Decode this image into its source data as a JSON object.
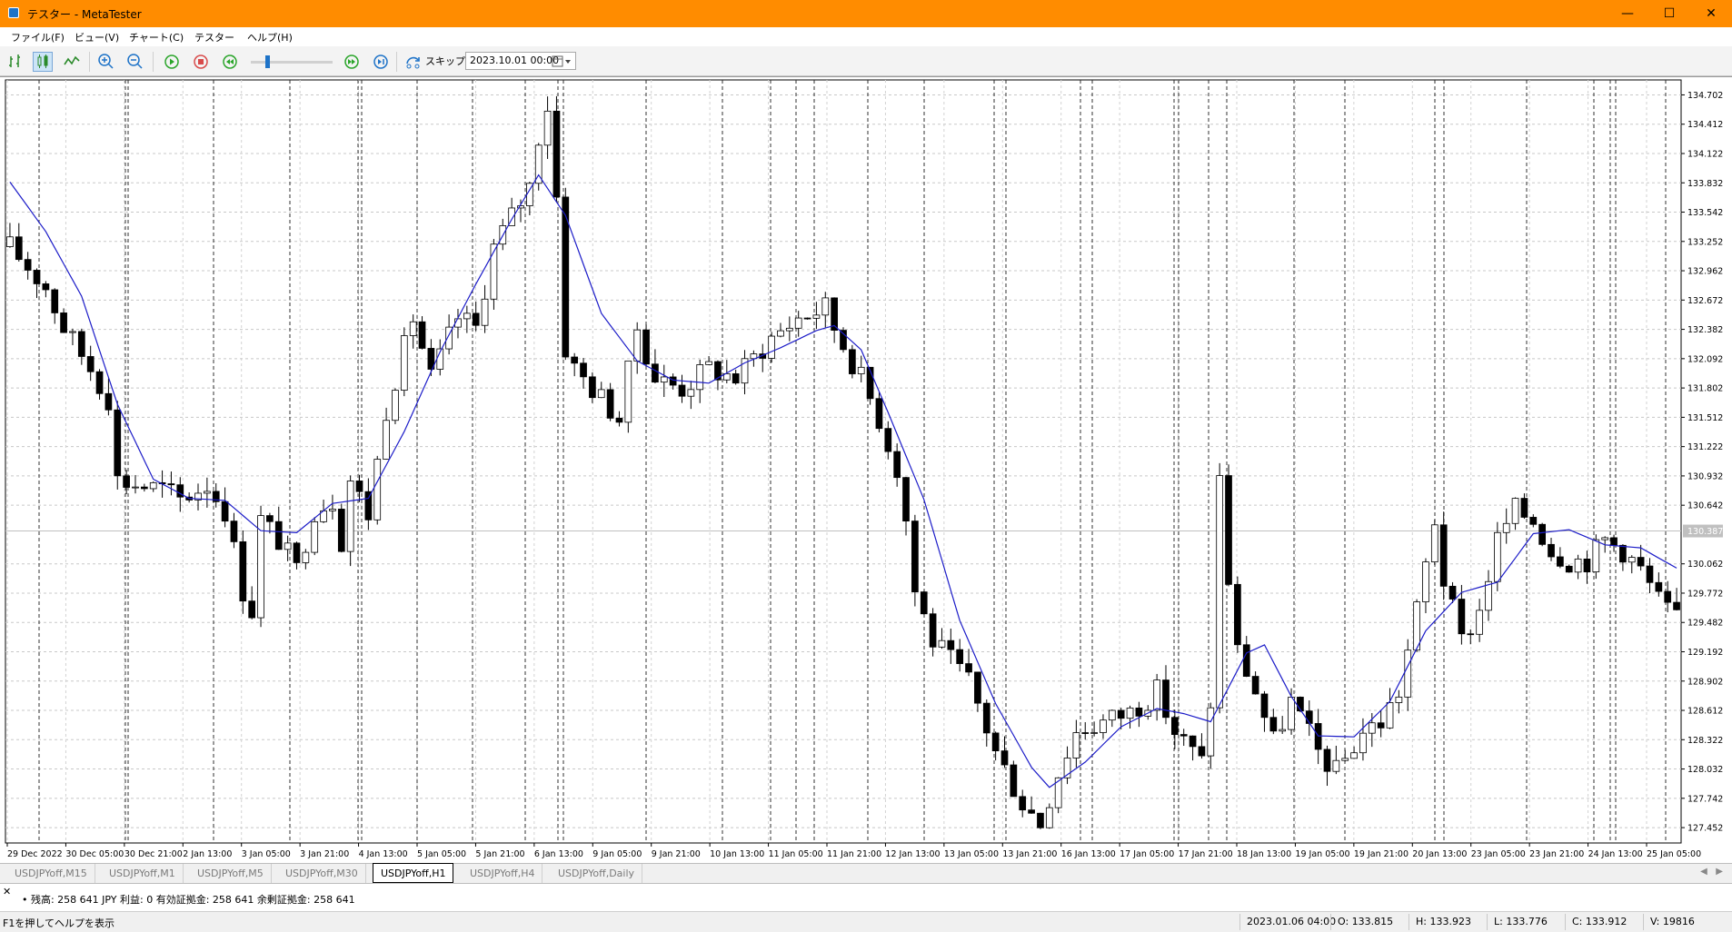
{
  "window": {
    "title": "テスター - MetaTester"
  },
  "menu": [
    "ファイル(F)",
    "ビュー(V)",
    "チャート(C)",
    "テスター",
    "ヘルプ(H)"
  ],
  "toolbar": {
    "skip_label": "スキップ",
    "date_value": "2023.10.01 00:00"
  },
  "chart_data": {
    "type": "candlestick",
    "symbol": "USDJPYoff",
    "timeframe": "H1",
    "ylim": [
      127.3,
      134.85
    ],
    "y_ticks": [
      "134.702",
      "134.412",
      "134.122",
      "133.832",
      "133.542",
      "133.252",
      "132.962",
      "132.672",
      "132.382",
      "132.092",
      "131.802",
      "131.512",
      "131.222",
      "130.932",
      "130.642",
      "130.062",
      "129.772",
      "129.482",
      "129.192",
      "128.902",
      "128.612",
      "128.322",
      "128.032",
      "127.742",
      "127.452"
    ],
    "current_price": "130.387",
    "x_ticks": [
      "29 Dec 2022",
      "30 Dec 05:00",
      "30 Dec 21:00",
      "2 Jan 13:00",
      "3 Jan 05:00",
      "3 Jan 21:00",
      "4 Jan 13:00",
      "5 Jan 05:00",
      "5 Jan 21:00",
      "6 Jan 13:00",
      "9 Jan 05:00",
      "9 Jan 21:00",
      "10 Jan 13:00",
      "11 Jan 05:00",
      "11 Jan 21:00",
      "12 Jan 13:00",
      "13 Jan 05:00",
      "13 Jan 21:00",
      "16 Jan 13:00",
      "17 Jan 05:00",
      "17 Jan 21:00",
      "18 Jan 13:00",
      "19 Jan 05:00",
      "19 Jan 21:00",
      "20 Jan 13:00",
      "23 Jan 05:00",
      "23 Jan 21:00",
      "24 Jan 13:00",
      "25 Jan 05:00"
    ],
    "price_path": [
      [
        0,
        133.2
      ],
      [
        4,
        132.8
      ],
      [
        6,
        132.4
      ],
      [
        9,
        132.0
      ],
      [
        11,
        131.7
      ],
      [
        12,
        130.9
      ],
      [
        14,
        130.85
      ],
      [
        17,
        130.8
      ],
      [
        19,
        130.7
      ],
      [
        22,
        130.85
      ],
      [
        24,
        130.6
      ],
      [
        26,
        129.8
      ],
      [
        27,
        129.6
      ],
      [
        28,
        130.5
      ],
      [
        30,
        130.3
      ],
      [
        32,
        130.0
      ],
      [
        34,
        130.6
      ],
      [
        36,
        130.7
      ],
      [
        37,
        130.3
      ],
      [
        38,
        130.9
      ],
      [
        40,
        130.55
      ],
      [
        42,
        131.6
      ],
      [
        45,
        132.5
      ],
      [
        47,
        131.9
      ],
      [
        50,
        132.5
      ],
      [
        52,
        132.4
      ],
      [
        54,
        133.2
      ],
      [
        56,
        133.5
      ],
      [
        58,
        133.8
      ],
      [
        59,
        134.3
      ],
      [
        60,
        134.6
      ],
      [
        61,
        133.7
      ],
      [
        62,
        132.2
      ],
      [
        63,
        132.0
      ],
      [
        66,
        131.7
      ],
      [
        68,
        131.5
      ],
      [
        70,
        132.4
      ],
      [
        72,
        131.9
      ],
      [
        75,
        131.8
      ],
      [
        78,
        132.0
      ],
      [
        81,
        131.9
      ],
      [
        85,
        132.3
      ],
      [
        88,
        132.5
      ],
      [
        91,
        132.6
      ],
      [
        92,
        132.4
      ],
      [
        95,
        131.9
      ],
      [
        97,
        131.5
      ],
      [
        99,
        131.0
      ],
      [
        100,
        130.5
      ],
      [
        101,
        129.8
      ],
      [
        103,
        129.3
      ],
      [
        107,
        128.9
      ],
      [
        110,
        128.2
      ],
      [
        113,
        127.7
      ],
      [
        115,
        127.5
      ],
      [
        117,
        128.0
      ],
      [
        119,
        128.4
      ],
      [
        122,
        128.5
      ],
      [
        125,
        128.6
      ],
      [
        128,
        128.8
      ],
      [
        130,
        128.4
      ],
      [
        133,
        128.1
      ],
      [
        134,
        128.7
      ],
      [
        135,
        130.9
      ],
      [
        136,
        129.9
      ],
      [
        137,
        129.2
      ],
      [
        139,
        128.8
      ],
      [
        141,
        128.3
      ],
      [
        143,
        128.7
      ],
      [
        146,
        128.2
      ],
      [
        148,
        128.0
      ],
      [
        151,
        128.4
      ],
      [
        153,
        128.5
      ],
      [
        155,
        128.8
      ],
      [
        157,
        129.6
      ],
      [
        159,
        130.5
      ],
      [
        160,
        129.9
      ],
      [
        162,
        129.3
      ],
      [
        164,
        129.6
      ],
      [
        166,
        130.3
      ],
      [
        168,
        130.6
      ],
      [
        170,
        130.5
      ],
      [
        172,
        130.2
      ],
      [
        174,
        130.1
      ],
      [
        176,
        130.1
      ],
      [
        178,
        130.3
      ],
      [
        180,
        130.2
      ],
      [
        182,
        130.0
      ],
      [
        184,
        129.7
      ],
      [
        186,
        129.5
      ]
    ],
    "ma_path": [
      [
        0,
        133.84
      ],
      [
        4,
        133.35
      ],
      [
        8,
        132.71
      ],
      [
        12,
        131.64
      ],
      [
        16,
        130.9
      ],
      [
        20,
        130.71
      ],
      [
        24,
        130.69
      ],
      [
        28,
        130.39
      ],
      [
        32,
        130.37
      ],
      [
        36,
        130.66
      ],
      [
        40,
        130.71
      ],
      [
        44,
        131.37
      ],
      [
        48,
        132.16
      ],
      [
        52,
        132.83
      ],
      [
        56,
        133.47
      ],
      [
        59,
        133.91
      ],
      [
        62,
        133.51
      ],
      [
        66,
        132.54
      ],
      [
        70,
        132.07
      ],
      [
        74,
        131.88
      ],
      [
        78,
        131.85
      ],
      [
        82,
        132.05
      ],
      [
        86,
        132.2
      ],
      [
        90,
        132.37
      ],
      [
        92,
        132.42
      ],
      [
        95,
        132.18
      ],
      [
        98,
        131.56
      ],
      [
        102,
        130.7
      ],
      [
        106,
        129.5
      ],
      [
        110,
        128.68
      ],
      [
        114,
        128.05
      ],
      [
        116,
        127.85
      ],
      [
        120,
        128.1
      ],
      [
        124,
        128.45
      ],
      [
        128,
        128.63
      ],
      [
        131,
        128.58
      ],
      [
        134,
        128.5
      ],
      [
        138,
        129.18
      ],
      [
        140,
        129.26
      ],
      [
        143,
        128.75
      ],
      [
        146,
        128.36
      ],
      [
        150,
        128.35
      ],
      [
        154,
        128.7
      ],
      [
        158,
        129.4
      ],
      [
        162,
        129.78
      ],
      [
        166,
        129.88
      ],
      [
        170,
        130.36
      ],
      [
        174,
        130.4
      ],
      [
        178,
        130.25
      ],
      [
        182,
        130.22
      ],
      [
        186,
        130.02
      ]
    ]
  },
  "tabs": [
    "USDJPYoff,M15",
    "USDJPYoff,M1",
    "USDJPYoff,M5",
    "USDJPYoff,M30",
    "USDJPYoff,H1",
    "USDJPYoff,H4",
    "USDJPYoff,Daily"
  ],
  "active_tab": 4,
  "account": {
    "text": "• 残高: 258 641 JPY  利益: 0  有効証拠金: 258 641  余剰証拠金: 258 641"
  },
  "status": {
    "help": "F1を押してヘルプを表示",
    "datetime": "2023.01.06 04:00",
    "open": "O: 133.815",
    "high": "H: 133.923",
    "low": "L: 133.776",
    "close": "C: 133.912",
    "volume": "V: 19816"
  }
}
